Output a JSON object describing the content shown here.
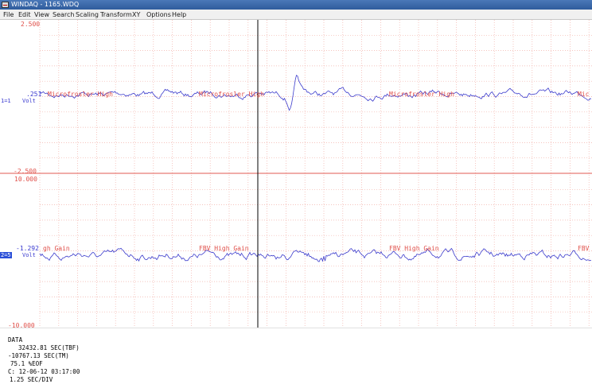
{
  "window": {
    "title": "WINDAQ - 1165.WDQ",
    "icon": "windaq-app-icon"
  },
  "menu": [
    "File",
    "Edit",
    "View",
    "Search",
    "Scaling",
    "Transform",
    "XY",
    "Options",
    "Help"
  ],
  "channels": [
    {
      "top_scale": "2.500",
      "cursor_value": ".251",
      "bottom_scale": "-2.500",
      "channel_id": "1=1",
      "unit": "Volt",
      "annotations": [
        "Microfrosler High",
        "Microfrosler High",
        "Microfrosler High",
        "Mic"
      ],
      "selected": false
    },
    {
      "top_scale": "10.000",
      "cursor_value": "-1.292",
      "bottom_scale": "-10.000",
      "channel_id": "2=5",
      "unit": "Volt",
      "annotations": [
        "gh Gain",
        "FBV High Gain",
        "FBV High Gain",
        "FBV"
      ],
      "selected": true
    }
  ],
  "status": {
    "mode": "DATA",
    "time_before": "32432.81 SEC(TBF)",
    "time_marker": "-10767.13 SEC(TM)",
    "eof": "75.1 %EOF",
    "channel_datetime": "C: 12-06-12 03:17:00",
    "time_per_div": "1.25 SEC/DIV"
  },
  "colors": {
    "grid": "#f2b0a8",
    "trace": "#3b3bcc",
    "divider": "#e05a50",
    "cursor": "#000000"
  }
}
